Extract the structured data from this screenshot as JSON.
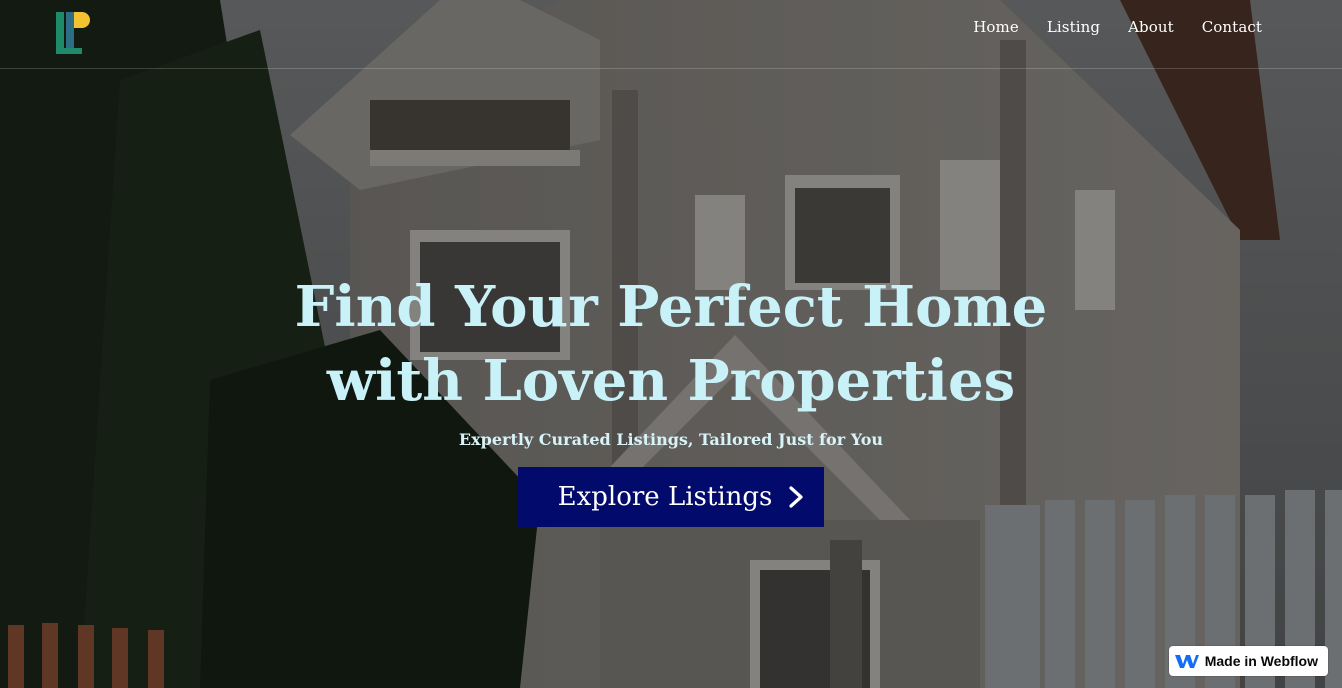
{
  "nav": {
    "links": [
      "Home",
      "Listing",
      "About",
      "Contact"
    ]
  },
  "hero": {
    "title": "Find Your Perfect Home with Loven Properties",
    "subtitle": "Expertly Curated Listings, Tailored Just for You",
    "cta_label": "Explore Listings",
    "cta_icon": "chevron-right-icon"
  },
  "badge": {
    "label": "Made in Webflow",
    "icon": "webflow-logo-icon"
  },
  "colors": {
    "title": "#c9f1f8",
    "cta_background": "#020a6b",
    "logo_green": "#1f8a6a",
    "logo_yellow": "#f2c230",
    "webflow_blue": "#146ef5"
  }
}
